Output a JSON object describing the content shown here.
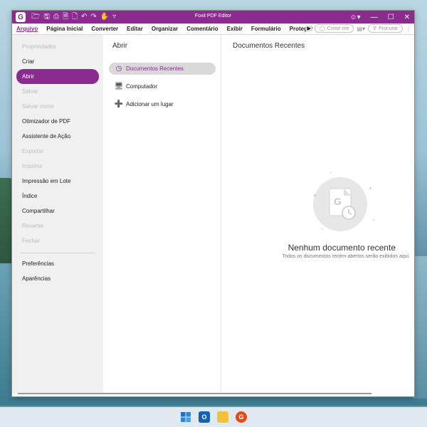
{
  "window": {
    "title": "Foxit PDF Editor"
  },
  "menubar": {
    "items": [
      "Arquivo",
      "Página Inicial",
      "Converter",
      "Editar",
      "Organizar",
      "Comentário",
      "Exibir",
      "Formulário",
      "Proteger"
    ],
    "tell_me_placeholder": "Conte-me",
    "search_placeholder": "Procurar"
  },
  "left_menu": {
    "group1": [
      {
        "label": "Propriedades",
        "disabled": true
      },
      {
        "label": "Criar",
        "disabled": false
      },
      {
        "label": "Abrir",
        "disabled": false,
        "selected": true
      },
      {
        "label": "Salvar",
        "disabled": true
      },
      {
        "label": "Salvar como",
        "disabled": true
      },
      {
        "label": "Otimizador de PDF",
        "disabled": false
      },
      {
        "label": "Assistente de Ação",
        "disabled": false
      },
      {
        "label": "Exportar",
        "disabled": true
      },
      {
        "label": "Imprimir",
        "disabled": true
      },
      {
        "label": "Impressão em Lote",
        "disabled": false
      },
      {
        "label": "Índice",
        "disabled": false
      },
      {
        "label": "Compartilhar",
        "disabled": false
      },
      {
        "label": "Reverter",
        "disabled": true
      },
      {
        "label": "Fechar",
        "disabled": true
      }
    ],
    "group2": [
      {
        "label": "Preferências",
        "disabled": false
      },
      {
        "label": "Aparências",
        "disabled": false
      }
    ]
  },
  "open_panel": {
    "title": "Abrir",
    "options": [
      {
        "label": "Documentos Recentes",
        "icon": "clock-icon",
        "selected": true
      },
      {
        "label": "Computador",
        "icon": "monitor-icon",
        "selected": false
      },
      {
        "label": "Adicionar um lugar",
        "icon": "add-place-icon",
        "selected": false
      }
    ]
  },
  "recent_panel": {
    "title": "Documentos Recentes",
    "empty_title": "Nenhum documento recente",
    "empty_subtitle": "Todos os documentos recém-abertos serão exibidos aqui."
  },
  "colors": {
    "accent": "#8b2b8f"
  }
}
